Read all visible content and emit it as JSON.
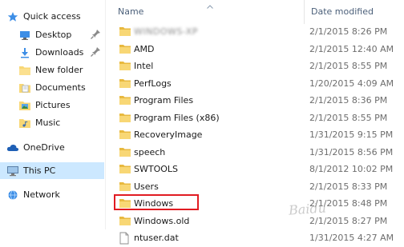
{
  "nav": {
    "items": [
      {
        "label": "Quick access",
        "icon": "star-icon"
      },
      {
        "label": "Desktop",
        "icon": "desktop-folder-icon",
        "pinned": true
      },
      {
        "label": "Downloads",
        "icon": "downloads-folder-icon",
        "pinned": true
      },
      {
        "label": "New folder",
        "icon": "folder-icon"
      },
      {
        "label": "Documents",
        "icon": "documents-folder-icon"
      },
      {
        "label": "Pictures",
        "icon": "pictures-folder-icon"
      },
      {
        "label": "Music",
        "icon": "music-folder-icon"
      },
      {
        "label": "OneDrive",
        "icon": "cloud-icon"
      },
      {
        "label": "This PC",
        "icon": "computer-icon",
        "selected": true
      },
      {
        "label": "Network",
        "icon": "network-icon"
      }
    ]
  },
  "columns": {
    "name": "Name",
    "date_modified": "Date modified"
  },
  "files": [
    {
      "name": "WINDOWS-XP",
      "date": "2/1/2015 8:26 PM",
      "type": "folder",
      "blurred": true
    },
    {
      "name": "AMD",
      "date": "2/1/2015 12:40 AM",
      "type": "folder"
    },
    {
      "name": "Intel",
      "date": "2/1/2015 8:55 PM",
      "type": "folder"
    },
    {
      "name": "PerfLogs",
      "date": "1/20/2015 4:09 AM",
      "type": "folder"
    },
    {
      "name": "Program Files",
      "date": "2/1/2015 8:36 PM",
      "type": "folder"
    },
    {
      "name": "Program Files (x86)",
      "date": "2/1/2015 8:55 PM",
      "type": "folder"
    },
    {
      "name": "RecoveryImage",
      "date": "1/31/2015 9:15 PM",
      "type": "folder"
    },
    {
      "name": "speech",
      "date": "1/31/2015 8:56 PM",
      "type": "folder"
    },
    {
      "name": "SWTOOLS",
      "date": "8/1/2012 10:02 PM",
      "type": "folder"
    },
    {
      "name": "Users",
      "date": "2/1/2015 8:33 PM",
      "type": "folder"
    },
    {
      "name": "Windows",
      "date": "2/1/2015 8:48 PM",
      "type": "folder"
    },
    {
      "name": "Windows.old",
      "date": "2/1/2015 8:27 PM",
      "type": "folder",
      "highlighted": true
    },
    {
      "name": "ntuser.dat",
      "date": "1/31/2015 4:27 AM",
      "type": "file"
    }
  ],
  "watermark": "Baidu",
  "colors": {
    "selected_bg": "#cce8ff",
    "highlight_border": "#e11b22",
    "folder_yellow": "#f8d775",
    "header_text": "#4c607a"
  }
}
